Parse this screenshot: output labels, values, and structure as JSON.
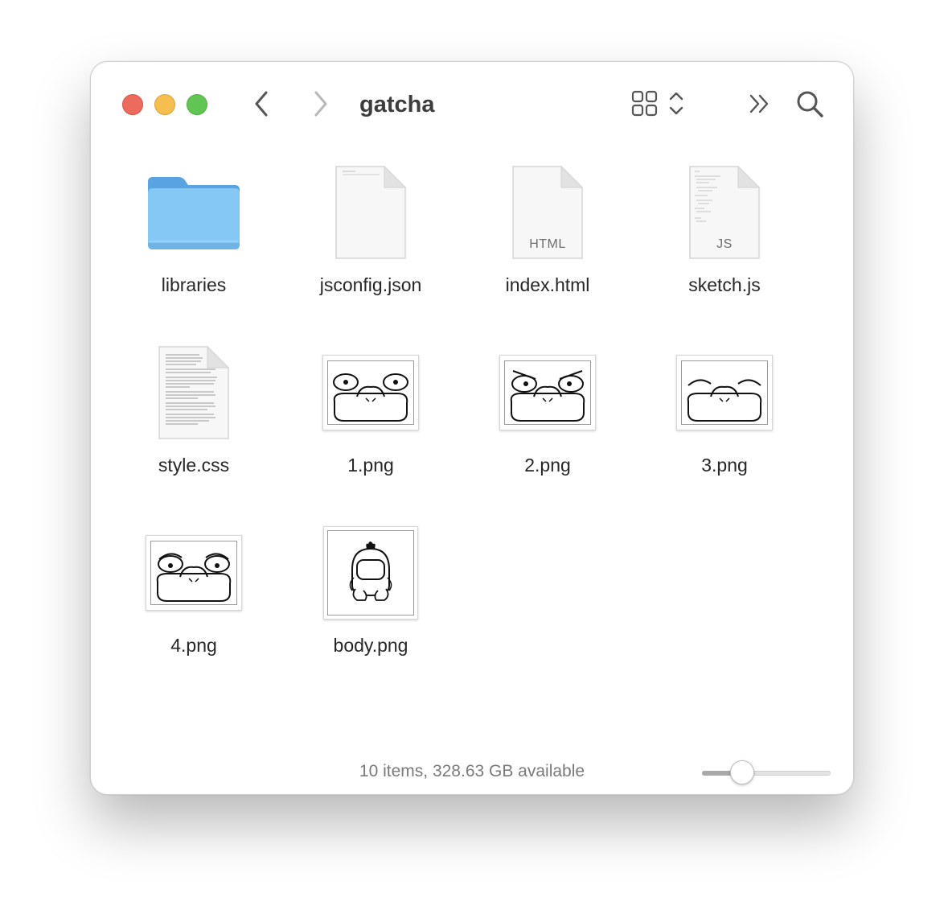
{
  "window": {
    "title": "gatcha"
  },
  "toolbar": {
    "back_icon": "chevron-left-icon",
    "forward_icon": "chevron-right-icon",
    "view_icon": "grid-view-icon",
    "more_icon": "double-chevron-right-icon",
    "search_icon": "magnifier-icon"
  },
  "items": [
    {
      "name": "libraries",
      "kind": "folder"
    },
    {
      "name": "jsconfig.json",
      "kind": "doc-blank"
    },
    {
      "name": "index.html",
      "kind": "doc-tag",
      "tag": "HTML"
    },
    {
      "name": "sketch.js",
      "kind": "doc-tag",
      "tag": "JS"
    },
    {
      "name": "style.css",
      "kind": "doc-text"
    },
    {
      "name": "1.png",
      "kind": "image",
      "face": "open-eyes"
    },
    {
      "name": "2.png",
      "kind": "image",
      "face": "angry-eyes"
    },
    {
      "name": "3.png",
      "kind": "image",
      "face": "closed-eyes"
    },
    {
      "name": "4.png",
      "kind": "image",
      "face": "worried-eyes"
    },
    {
      "name": "body.png",
      "kind": "image",
      "face": "body"
    }
  ],
  "status": {
    "text": "10 items, 328.63 GB available"
  },
  "zoom_slider": {
    "value": 0.27
  },
  "colors": {
    "folder": "#7dc4f2",
    "close": "#ec6a5e",
    "minimize": "#f5be4f",
    "maximize": "#61c554"
  }
}
